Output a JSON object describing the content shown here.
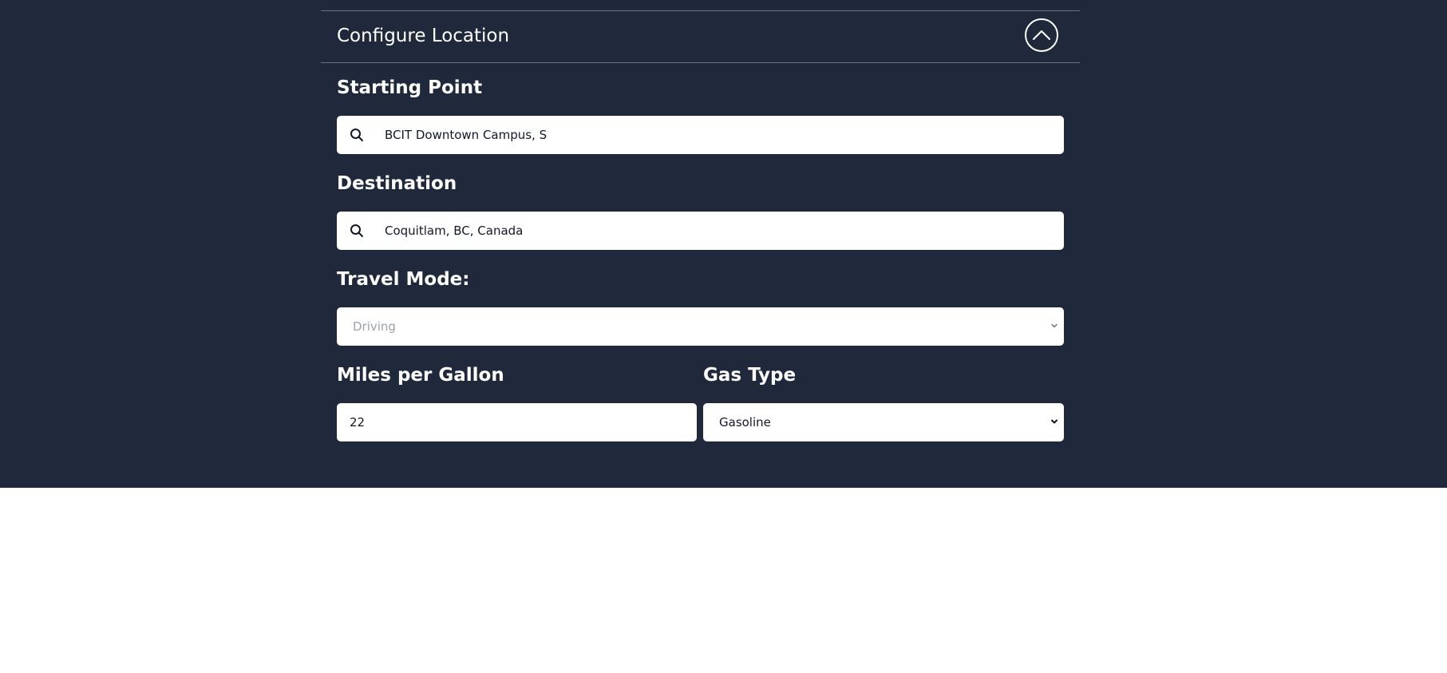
{
  "header": {
    "title": "Configure Location",
    "collapse_icon": "chevron-up-icon"
  },
  "starting_point": {
    "label": "Starting Point",
    "value": "BCIT Downtown Campus, S",
    "icon": "search-icon"
  },
  "destination": {
    "label": "Destination",
    "value": "Coquitlam, BC, Canada",
    "icon": "search-icon"
  },
  "travel_mode": {
    "label": "Travel Mode:",
    "selected": "Driving"
  },
  "mpg": {
    "label": "Miles per Gallon",
    "value": "22"
  },
  "gas_type": {
    "label": "Gas Type",
    "selected": "Gasoline"
  },
  "colors": {
    "panel_bg": "#1f293b",
    "text_light": "#ffffff",
    "field_bg": "#ffffff",
    "placeholder": "#9ca3af"
  }
}
